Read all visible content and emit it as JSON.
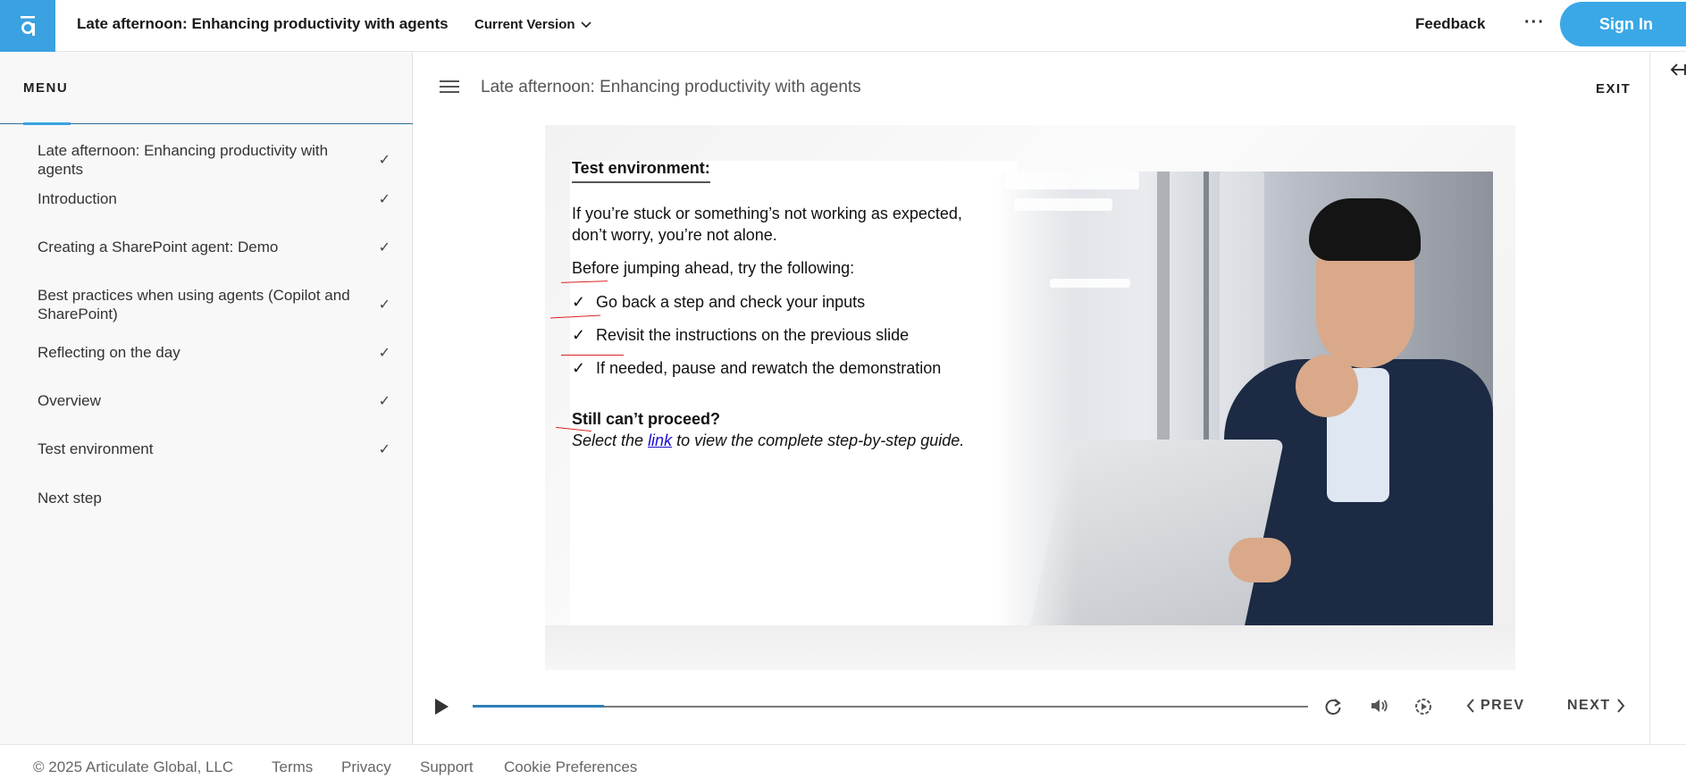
{
  "header": {
    "doc_title": "Late afternoon: Enhancing productivity with agents",
    "version_label": "Current Version",
    "feedback_label": "Feedback",
    "more_label": "···",
    "signin_label": "Sign In",
    "accent_color": "#3aa2e0"
  },
  "sidebar": {
    "menu_label": "MENU",
    "items": [
      {
        "label": "Late afternoon: Enhancing productivity with agents",
        "completed": true,
        "check": "✓"
      },
      {
        "label": "Introduction",
        "completed": true,
        "check": "✓"
      },
      {
        "label": "Creating a SharePoint agent: Demo",
        "completed": true,
        "check": "✓"
      },
      {
        "label": "Best practices when using agents (Copilot and SharePoint)",
        "completed": true,
        "check": "✓"
      },
      {
        "label": "Reflecting on the day",
        "completed": true,
        "check": "✓"
      },
      {
        "label": "Overview",
        "completed": true,
        "check": "✓"
      },
      {
        "label": "Test environment",
        "completed": true,
        "check": "✓"
      },
      {
        "label": "Next step",
        "completed": false,
        "check": ""
      }
    ]
  },
  "main": {
    "lesson_title": "Late afternoon: Enhancing productivity with agents",
    "exit_label": "EXIT",
    "collapse_icon": "arrow-left-bar-icon"
  },
  "slide": {
    "heading": "Test environment:",
    "intro": "If you’re stuck or something’s not working as expected, don’t worry, you’re not alone.",
    "before": "Before jumping ahead, try the following:",
    "bullet_mark": "✓",
    "bullets": [
      "Go back a step and check your inputs",
      "Revisit the instructions on the previous slide",
      "If needed, pause and rewatch the demonstration"
    ],
    "still_heading": "Still can’t proceed?",
    "select_prefix": "Select the ",
    "link_text": "link",
    "select_suffix": " to view the complete step-by-step guide."
  },
  "player": {
    "progress": 0.157,
    "prev_label": "PREV",
    "next_label": "NEXT"
  },
  "footer": {
    "copyright": "© 2025 Articulate Global, LLC",
    "terms": "Terms",
    "privacy": "Privacy",
    "support": "Support",
    "cookies": "Cookie Preferences"
  }
}
